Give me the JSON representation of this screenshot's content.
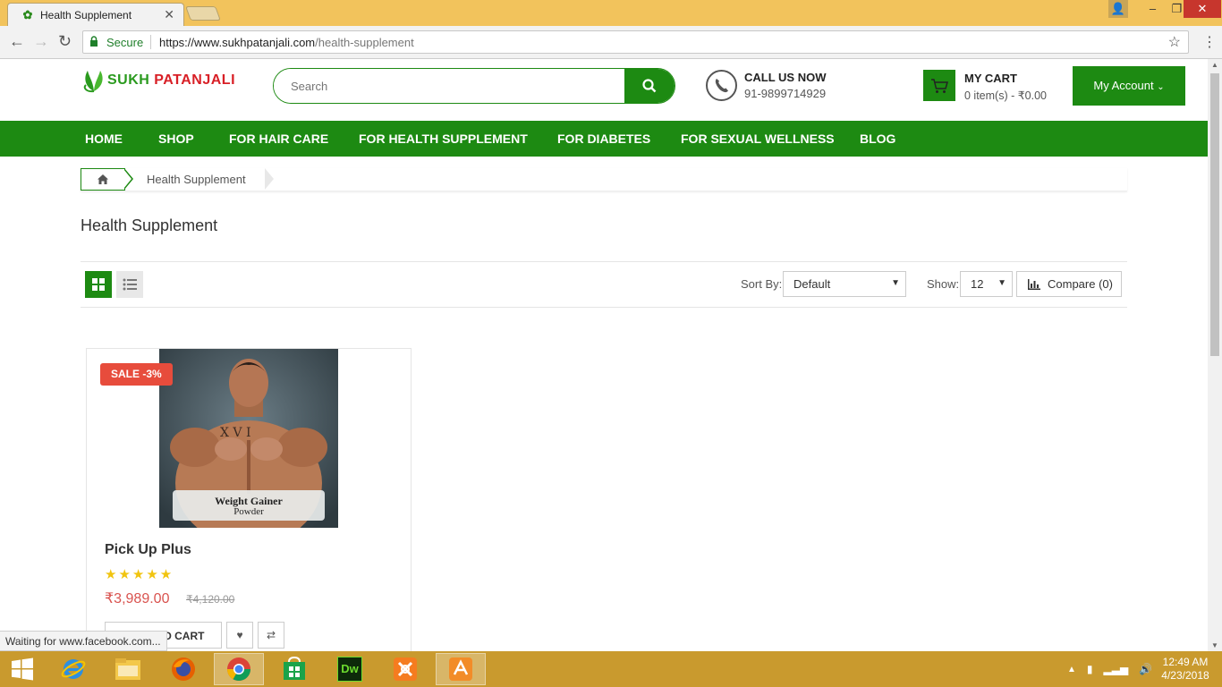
{
  "browser": {
    "tab_title": "Health Supplement",
    "secure_label": "Secure",
    "url_base": "https://www.sukhpatanjali.com",
    "url_path": "/health-supplement",
    "status_text": "Waiting for www.facebook.com..."
  },
  "header": {
    "logo_left": "SUKH",
    "logo_right": "PATANJALI",
    "search_placeholder": "Search",
    "call_title": "CALL US NOW",
    "call_number": "91-9899714929",
    "cart_title": "MY CART",
    "cart_items": "0 item(s) - ₹0.00",
    "account_label": "My Account"
  },
  "nav": {
    "items": [
      "HOME",
      "SHOP",
      "FOR HAIR CARE",
      "FOR HEALTH SUPPLEMENT",
      "FOR DIABETES",
      "FOR SEXUAL WELLNESS",
      "BLOG"
    ]
  },
  "breadcrumb": {
    "current": "Health Supplement"
  },
  "listing": {
    "title": "Health Supplement",
    "sort_label": "Sort By:",
    "sort_value": "Default",
    "show_label": "Show:",
    "show_value": "12",
    "compare_label": "Compare (0)"
  },
  "product": {
    "badge": "SALE -3%",
    "image_caption_1": "Weight Gainer",
    "image_caption_2": "Powder",
    "name": "Pick Up Plus",
    "rating": 5,
    "stars": "★★★★★",
    "price": "₹3,989.00",
    "old_price": "₹4,120.00",
    "add_to_cart": "Add to Cart"
  },
  "taskbar": {
    "time": "12:49 AM",
    "date": "4/23/2018"
  },
  "colors": {
    "brand_green": "#1d8a12",
    "sale_red": "#e74c3c",
    "price_red": "#d9534f",
    "chrome_gold": "#f2c35c"
  }
}
